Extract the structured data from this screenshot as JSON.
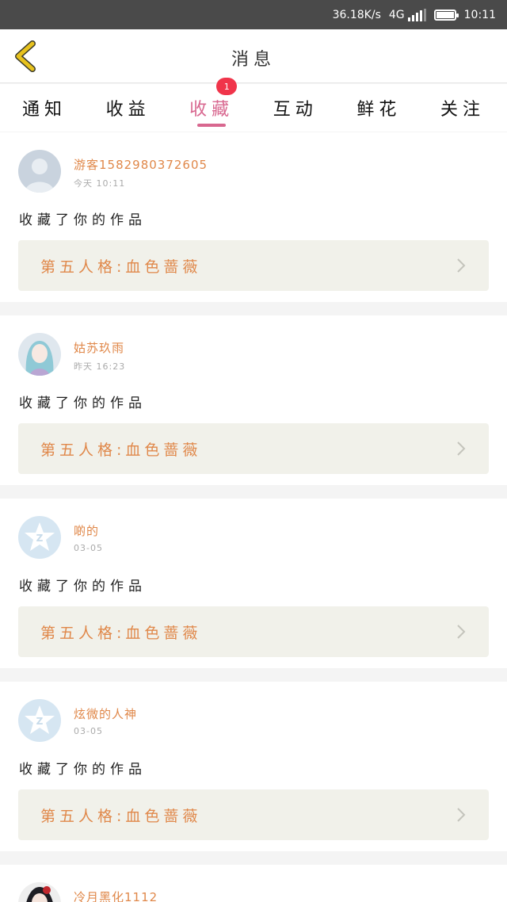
{
  "status_bar": {
    "net_speed": "36.18K/s",
    "network": "4G",
    "time": "10:11"
  },
  "header": {
    "back_icon": "chevron-left-icon",
    "title": "消息"
  },
  "tabs": [
    {
      "label": "通知",
      "active": false
    },
    {
      "label": "收益",
      "active": false
    },
    {
      "label": "收藏",
      "active": true,
      "badge": "1"
    },
    {
      "label": "互动",
      "active": false
    },
    {
      "label": "鲜花",
      "active": false
    },
    {
      "label": "关注",
      "active": false
    }
  ],
  "colors": {
    "accent": "#d8678f",
    "name": "#e0884a",
    "badge": "#f0344a",
    "card_link_bg": "#f1f1ea",
    "back_icon": "#e7c21e"
  },
  "feed": [
    {
      "name": "游客1582980372605",
      "time": "今天 10:11",
      "action": "收藏了你的作品",
      "work": "第五人格:血色蔷薇",
      "avatar": "default-avatar-icon"
    },
    {
      "name": "姑苏玖雨",
      "time": "昨天 16:23",
      "action": "收藏了你的作品",
      "work": "第五人格:血色蔷薇",
      "avatar": "anime-avatar"
    },
    {
      "name": "啲的",
      "time": "03-05",
      "action": "收藏了你的作品",
      "work": "第五人格:血色蔷薇",
      "avatar": "qzone-avatar-icon"
    },
    {
      "name": "炫微的人神",
      "time": "03-05",
      "action": "收藏了你的作品",
      "work": "第五人格:血色蔷薇",
      "avatar": "qzone-avatar-icon"
    },
    {
      "name": "冷月黑化1112",
      "time": "",
      "action": "",
      "work": "",
      "avatar": "anime-avatar"
    }
  ]
}
